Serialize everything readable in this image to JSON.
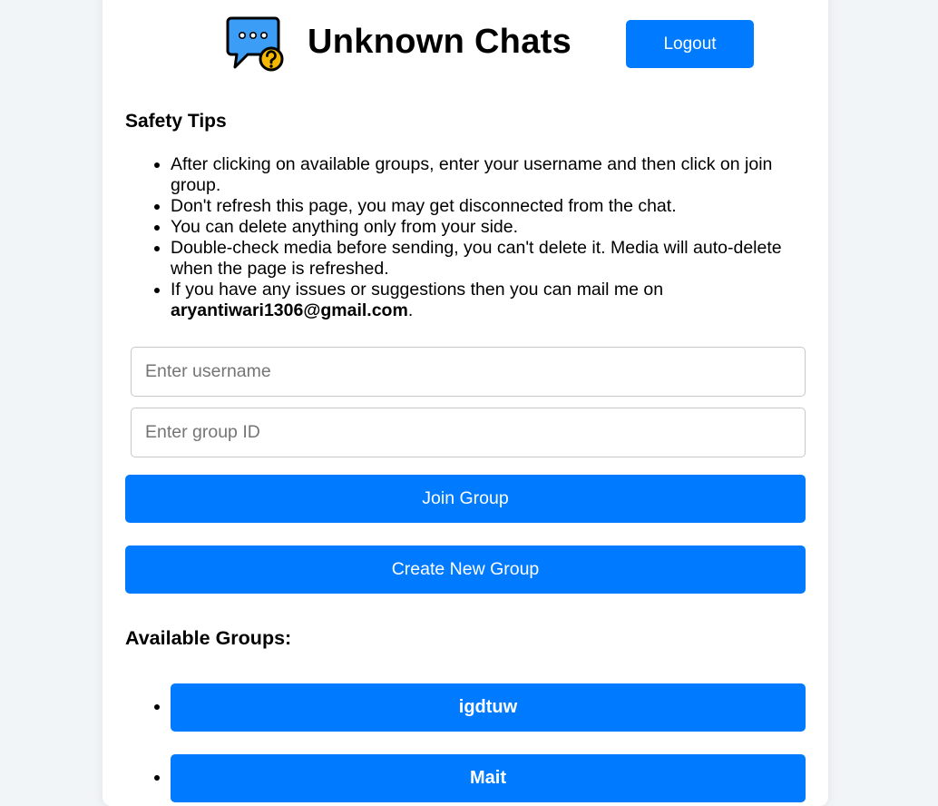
{
  "header": {
    "title": "Unknown Chats",
    "logout_label": "Logout",
    "logo_icon": "chat-bubble-question-icon"
  },
  "safety": {
    "heading": "Safety Tips",
    "tips": [
      "After clicking on available groups, enter your username and then click on join group.",
      "Don't refresh this page, you may get disconnected from the chat.",
      "You can delete anything only from your side.",
      "Double-check media before sending, you can't delete it. Media will auto-delete when the page is refreshed.",
      "If you have any issues or suggestions then you can mail me on"
    ],
    "email": "aryantiwari1306@gmail.com",
    "email_suffix": "."
  },
  "form": {
    "username_placeholder": "Enter username",
    "username_value": "",
    "group_id_placeholder": "Enter group ID",
    "group_id_value": "",
    "join_label": "Join Group",
    "create_label": "Create New Group"
  },
  "groups": {
    "heading": "Available Groups:",
    "items": [
      {
        "label": "igdtuw"
      },
      {
        "label": "Mait"
      }
    ]
  },
  "colors": {
    "accent": "#007bff",
    "background": "#f2f5f8",
    "card": "#ffffff",
    "logo_bubble": "#3b9df5",
    "logo_badge": "#f5b800"
  }
}
